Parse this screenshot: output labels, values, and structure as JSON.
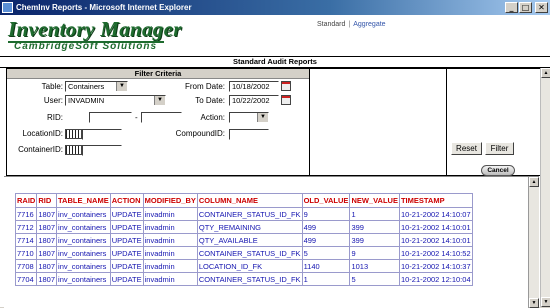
{
  "window": {
    "title": "ChemInv Reports - Microsoft Internet Explorer",
    "minimize": "_",
    "maximize": "□",
    "close": "✕"
  },
  "header": {
    "logo_main": "Inventory Manager",
    "logo_sub": "CambridgeSoft Solutions"
  },
  "nav": {
    "standard": "Standard",
    "separator": "|",
    "aggregate": "Aggregate"
  },
  "report_title": "Standard Audit Reports",
  "filter": {
    "heading": "Filter Criteria",
    "table_label": "Table:",
    "table_value": "Containers",
    "user_label": "User:",
    "user_value": "INVADMIN",
    "rid_label": "RID:",
    "rid_from": "",
    "rid_dash": "-",
    "rid_to": "",
    "locationid_label": "LocationID:",
    "locationid_value": "",
    "containerid_label": "ContainerID:",
    "containerid_value": "",
    "fromdate_label": "From Date:",
    "fromdate_value": "10/18/2002",
    "todate_label": "To Date:",
    "todate_value": "10/22/2002",
    "action_label": "Action:",
    "action_value": "",
    "compoundid_label": "CompoundID:",
    "compoundid_value": ""
  },
  "buttons": {
    "reset": "Reset",
    "filter": "Filter",
    "cancel": "Cancel"
  },
  "results": {
    "columns": [
      "RAID",
      "RID",
      "TABLE_NAME",
      "ACTION",
      "MODIFIED_BY",
      "COLUMN_NAME",
      "OLD_VALUE",
      "NEW_VALUE",
      "TIMESTAMP"
    ],
    "rows": [
      [
        "7716",
        "1807",
        "inv_containers",
        "UPDATE",
        "invadmin",
        "CONTAINER_STATUS_ID_FK",
        "9",
        "1",
        "10-21-2002 14:10:07"
      ],
      [
        "7712",
        "1807",
        "inv_containers",
        "UPDATE",
        "invadmin",
        "QTY_REMAINING",
        "499",
        "399",
        "10-21-2002 14:10:01"
      ],
      [
        "7714",
        "1807",
        "inv_containers",
        "UPDATE",
        "invadmin",
        "QTY_AVAILABLE",
        "499",
        "399",
        "10-21-2002 14:10:01"
      ],
      [
        "7710",
        "1807",
        "inv_containers",
        "UPDATE",
        "invadmin",
        "CONTAINER_STATUS_ID_FK",
        "5",
        "9",
        "10-21-2002 14:10:52"
      ],
      [
        "7708",
        "1807",
        "inv_containers",
        "UPDATE",
        "invadmin",
        "LOCATION_ID_FK",
        "1140",
        "1013",
        "10-21-2002 14:10:37"
      ],
      [
        "7704",
        "1807",
        "inv_containers",
        "UPDATE",
        "invadmin",
        "CONTAINER_STATUS_ID_FK",
        "1",
        "5",
        "10-21-2002 12:10:04"
      ]
    ]
  },
  "scroll": {
    "up": "▲",
    "down": "▼"
  }
}
